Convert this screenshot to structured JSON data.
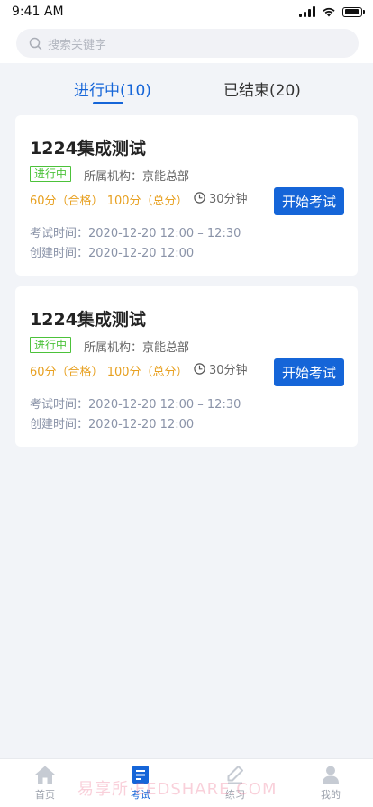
{
  "status_bar": {
    "time": "9:41 AM"
  },
  "search": {
    "placeholder": "搜索关键字"
  },
  "tabs": [
    {
      "label": "进行中(10)",
      "active": true
    },
    {
      "label": "已结束(20)",
      "active": false
    }
  ],
  "exams": [
    {
      "title": "1224集成测试",
      "status": "进行中",
      "org": "所属机构：京能总部",
      "pass_score": "60分（合格）",
      "total_score": "100分（总分）",
      "duration": "30分钟",
      "action": "开始考试",
      "exam_time": "考试时间：2020-12-20 12:00 – 12:30",
      "created_time": "创建时间：2020-12-20 12:00"
    },
    {
      "title": "1224集成测试",
      "status": "进行中",
      "org": "所属机构：京能总部",
      "pass_score": "60分（合格）",
      "total_score": "100分（总分）",
      "duration": "30分钟",
      "action": "开始考试",
      "exam_time": "考试时间：2020-12-20 12:00 – 12:30",
      "created_time": "创建时间：2020-12-20 12:00"
    }
  ],
  "bottom_nav": [
    {
      "label": "首页",
      "icon": "home-icon",
      "active": false
    },
    {
      "label": "考试",
      "icon": "exam-icon",
      "active": true
    },
    {
      "label": "练习",
      "icon": "practice-icon",
      "active": false
    },
    {
      "label": "我的",
      "icon": "profile-icon",
      "active": false
    }
  ],
  "watermark": "易享所·EEDSHARE.COM",
  "colors": {
    "accent": "#1565d8",
    "status_green": "#4cc23a",
    "score_orange": "#e7a020"
  }
}
